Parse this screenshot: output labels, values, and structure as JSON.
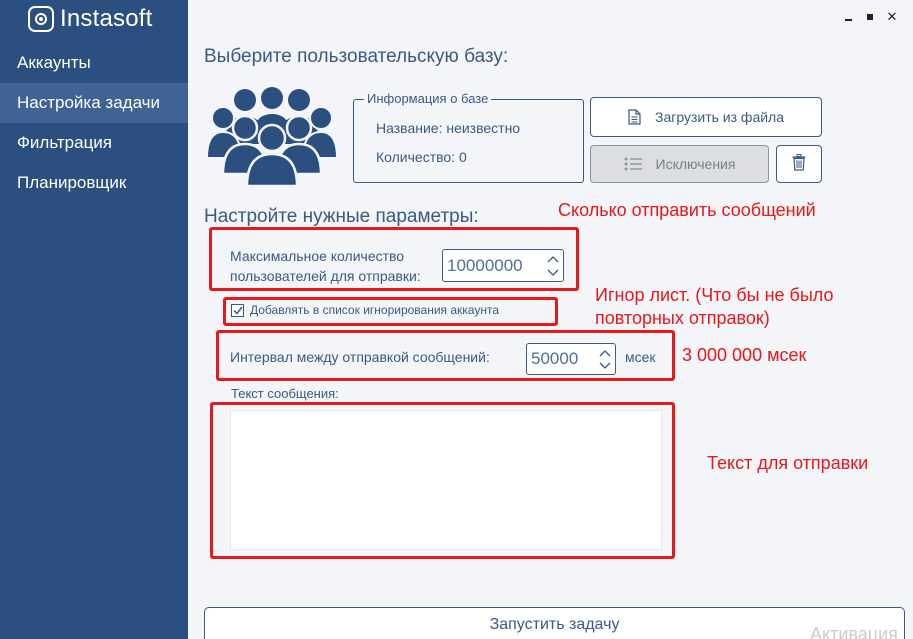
{
  "app": {
    "logo_text": "Instasoft"
  },
  "sidebar": {
    "items": [
      {
        "label": "Аккаунты",
        "active": false
      },
      {
        "label": "Настройка задачи",
        "active": true
      },
      {
        "label": "Фильтрация",
        "active": false
      },
      {
        "label": "Планировщик",
        "active": false
      }
    ]
  },
  "base": {
    "heading": "Выберите пользовательскую базу:",
    "info_legend": "Информация о базе",
    "name_line": "Название: неизвестно",
    "count_line": "Количество: 0",
    "load_button": "Загрузить из файла",
    "exclusions_button": "Исключения"
  },
  "params": {
    "heading": "Настройте нужные параметры:",
    "max_users_label_1": "Максимальное количество",
    "max_users_label_2": "пользователей для отправки:",
    "max_users_value": "10000000",
    "ignore_checkbox_label": "Добавлять в список игнорирования аккаунта",
    "ignore_checked": true,
    "interval_label": "Интервал между отправкой сообщений:",
    "interval_value": "50000",
    "interval_unit": "мсек",
    "message_label": "Текст сообщения:",
    "message_value": ""
  },
  "annotations": {
    "how_many": "Сколько отправить сообщений",
    "ignore_1": "Игнор лист. (Что бы не было",
    "ignore_2": "повторных отправок)",
    "interval_note": "3 000 000 мсек",
    "text_note": "Текст для отправки"
  },
  "footer": {
    "run_button": "Запустить задачу",
    "watermark": "Активация"
  },
  "colors": {
    "sidebar_bg": "#2b4f7e",
    "sidebar_active": "#3f6393",
    "accent_text": "#3a5a82",
    "annotation_red": "#e8171a"
  }
}
